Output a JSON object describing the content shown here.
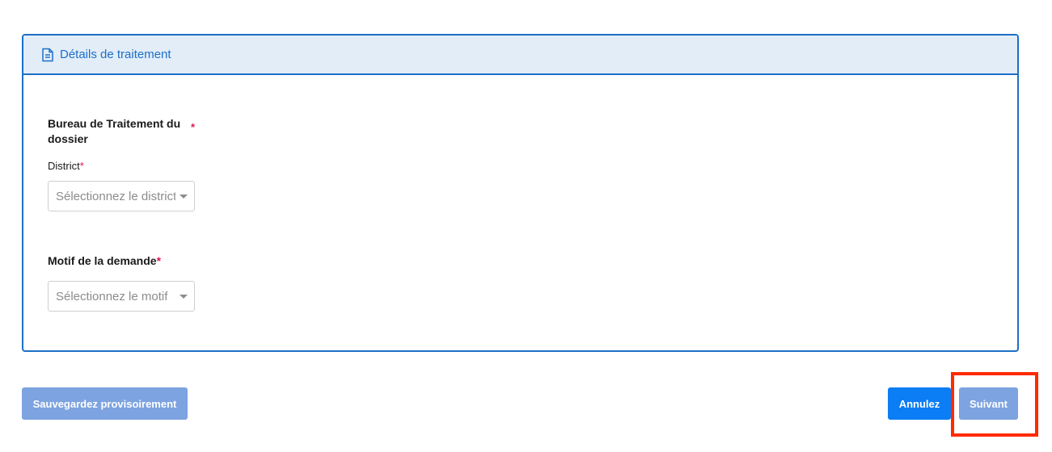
{
  "card": {
    "title": "Détails de traitement",
    "header_icon": "document-icon"
  },
  "bureau": {
    "title": "Bureau de Traitement du dossier",
    "required_mark": "*",
    "district_label": "District",
    "district_required_mark": "*",
    "district_placeholder": "Sélectionnez le district"
  },
  "motif": {
    "title": "Motif de la demande",
    "required_mark": "*",
    "placeholder": "Sélectionnez le motif"
  },
  "actions": {
    "save_draft_label": "Sauvegardez provisoirement",
    "cancel_label": "Annulez",
    "next_label": "Suivant"
  },
  "colors": {
    "primary": "#1c6fc7",
    "header_bg": "#e2edf8",
    "button_blue": "#0b7df5",
    "button_disabled": "#7da3e0",
    "required": "#e0174f",
    "highlight": "#ff2a00"
  }
}
